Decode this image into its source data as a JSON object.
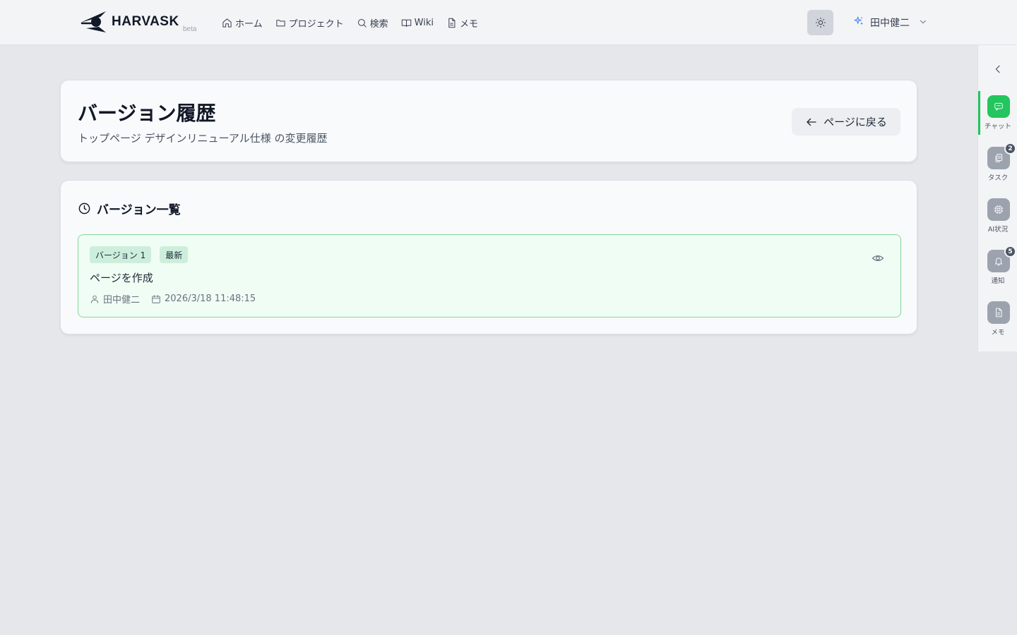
{
  "brand": {
    "name": "HARVASK",
    "tag": "beta"
  },
  "nav": {
    "items": [
      {
        "label": "ホーム",
        "icon": "home-icon"
      },
      {
        "label": "プロジェクト",
        "icon": "folder-icon"
      },
      {
        "label": "検索",
        "icon": "search-icon"
      },
      {
        "label": "Wiki",
        "icon": "book-icon"
      },
      {
        "label": "メモ",
        "icon": "file-text-icon"
      }
    ]
  },
  "theme_toggle": {
    "icon": "sun-icon"
  },
  "user": {
    "name": "田中健二",
    "icon": "sparkles-icon"
  },
  "sidebar": {
    "items": [
      {
        "label": "チャット",
        "icon": "chat-icon",
        "active": true,
        "badge": ""
      },
      {
        "label": "タスク",
        "icon": "copy-icon",
        "active": false,
        "badge": "2"
      },
      {
        "label": "AI状況",
        "icon": "cpu-icon",
        "active": false,
        "badge": ""
      },
      {
        "label": "通知",
        "icon": "bell-icon",
        "active": false,
        "badge": "5"
      },
      {
        "label": "メモ",
        "icon": "file-text-icon",
        "active": false,
        "badge": ""
      }
    ]
  },
  "header": {
    "title": "バージョン履歴",
    "subtitle": "トップページ デザインリニューアル仕様 の変更履歴",
    "back_label": "ページに戻る"
  },
  "versions": {
    "section_title": "バージョン一覧",
    "items": [
      {
        "version_label": "バージョン 1",
        "latest_label": "最新",
        "description": "ページを作成",
        "author": "田中健二",
        "timestamp": "2026/3/18 11:48:15"
      }
    ]
  },
  "colors": {
    "accent": "#22c55e",
    "background": "#e5e7eb",
    "card": "#f8fafc",
    "badge_bg": "#cdeedc"
  }
}
